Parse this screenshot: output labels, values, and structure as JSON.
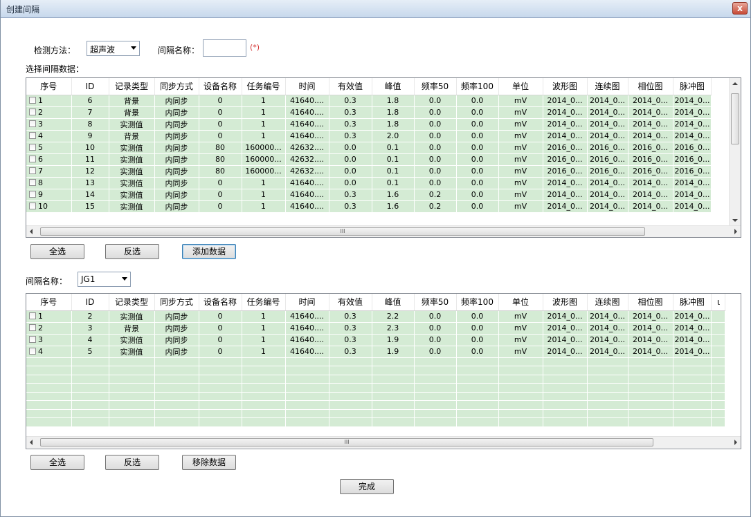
{
  "window": {
    "title": "创建间隔",
    "close_label": "x"
  },
  "form": {
    "method_label": "检测方法：",
    "method_value": "超声波",
    "interval_name_label": "间隔名称：",
    "interval_name_value": "",
    "required_mark": "(*)",
    "select_data_label": "选择间隔数据："
  },
  "columns": [
    "序号",
    "ID",
    "记录类型",
    "同步方式",
    "设备名称",
    "任务编号",
    "时间",
    "有效值",
    "峰值",
    "频率50",
    "频率100",
    "单位",
    "波形图",
    "连续图",
    "相位图",
    "脉冲图"
  ],
  "top_table": {
    "rows": [
      [
        "1",
        "6",
        "背景",
        "内同步",
        "0",
        "1",
        "41640....",
        "0.3",
        "1.8",
        "0.0",
        "0.0",
        "mV",
        "2014_0...",
        "2014_0...",
        "2014_0...",
        "2014_0..."
      ],
      [
        "2",
        "7",
        "背景",
        "内同步",
        "0",
        "1",
        "41640....",
        "0.3",
        "1.8",
        "0.0",
        "0.0",
        "mV",
        "2014_0...",
        "2014_0...",
        "2014_0...",
        "2014_0..."
      ],
      [
        "3",
        "8",
        "实测值",
        "内同步",
        "0",
        "1",
        "41640....",
        "0.3",
        "1.8",
        "0.0",
        "0.0",
        "mV",
        "2014_0...",
        "2014_0...",
        "2014_0...",
        "2014_0..."
      ],
      [
        "4",
        "9",
        "背景",
        "内同步",
        "0",
        "1",
        "41640....",
        "0.3",
        "2.0",
        "0.0",
        "0.0",
        "mV",
        "2014_0...",
        "2014_0...",
        "2014_0...",
        "2014_0..."
      ],
      [
        "5",
        "10",
        "实测值",
        "内同步",
        "80",
        "160000...",
        "42632....",
        "0.0",
        "0.1",
        "0.0",
        "0.0",
        "mV",
        "2016_0...",
        "2016_0...",
        "2016_0...",
        "2016_0..."
      ],
      [
        "6",
        "11",
        "实测值",
        "内同步",
        "80",
        "160000...",
        "42632....",
        "0.0",
        "0.1",
        "0.0",
        "0.0",
        "mV",
        "2016_0...",
        "2016_0...",
        "2016_0...",
        "2016_0..."
      ],
      [
        "7",
        "12",
        "实测值",
        "内同步",
        "80",
        "160000...",
        "42632....",
        "0.0",
        "0.1",
        "0.0",
        "0.0",
        "mV",
        "2016_0...",
        "2016_0...",
        "2016_0...",
        "2016_0..."
      ],
      [
        "8",
        "13",
        "实测值",
        "内同步",
        "0",
        "1",
        "41640....",
        "0.0",
        "0.1",
        "0.0",
        "0.0",
        "mV",
        "2014_0...",
        "2014_0...",
        "2014_0...",
        "2014_0..."
      ],
      [
        "9",
        "14",
        "实测值",
        "内同步",
        "0",
        "1",
        "41640....",
        "0.3",
        "1.6",
        "0.2",
        "0.0",
        "mV",
        "2014_0...",
        "2014_0...",
        "2014_0...",
        "2014_0..."
      ],
      [
        "10",
        "15",
        "实测值",
        "内同步",
        "0",
        "1",
        "41640....",
        "0.3",
        "1.6",
        "0.2",
        "0.0",
        "mV",
        "2014_0...",
        "2014_0...",
        "2014_0...",
        "2014_0..."
      ]
    ]
  },
  "top_buttons": {
    "select_all": "全选",
    "invert": "反选",
    "add": "添加数据"
  },
  "interval_select": {
    "label": "间隔名称：",
    "value": "JG1"
  },
  "bottom_table": {
    "last_header_partial": "ι",
    "rows": [
      [
        "1",
        "2",
        "实测值",
        "内同步",
        "0",
        "1",
        "41640....",
        "0.3",
        "2.2",
        "0.0",
        "0.0",
        "mV",
        "2014_0...",
        "2014_0...",
        "2014_0...",
        "2014_0..."
      ],
      [
        "2",
        "3",
        "背景",
        "内同步",
        "0",
        "1",
        "41640....",
        "0.3",
        "2.3",
        "0.0",
        "0.0",
        "mV",
        "2014_0...",
        "2014_0...",
        "2014_0...",
        "2014_0..."
      ],
      [
        "3",
        "4",
        "实测值",
        "内同步",
        "0",
        "1",
        "41640....",
        "0.3",
        "1.9",
        "0.0",
        "0.0",
        "mV",
        "2014_0...",
        "2014_0...",
        "2014_0...",
        "2014_0..."
      ],
      [
        "4",
        "5",
        "实测值",
        "内同步",
        "0",
        "1",
        "41640....",
        "0.3",
        "1.9",
        "0.0",
        "0.0",
        "mV",
        "2014_0...",
        "2014_0...",
        "2014_0...",
        "2014_0..."
      ]
    ]
  },
  "bottom_buttons": {
    "select_all": "全选",
    "invert": "反选",
    "remove": "移除数据"
  },
  "finish_button": "完成",
  "scroll_grip": "III"
}
